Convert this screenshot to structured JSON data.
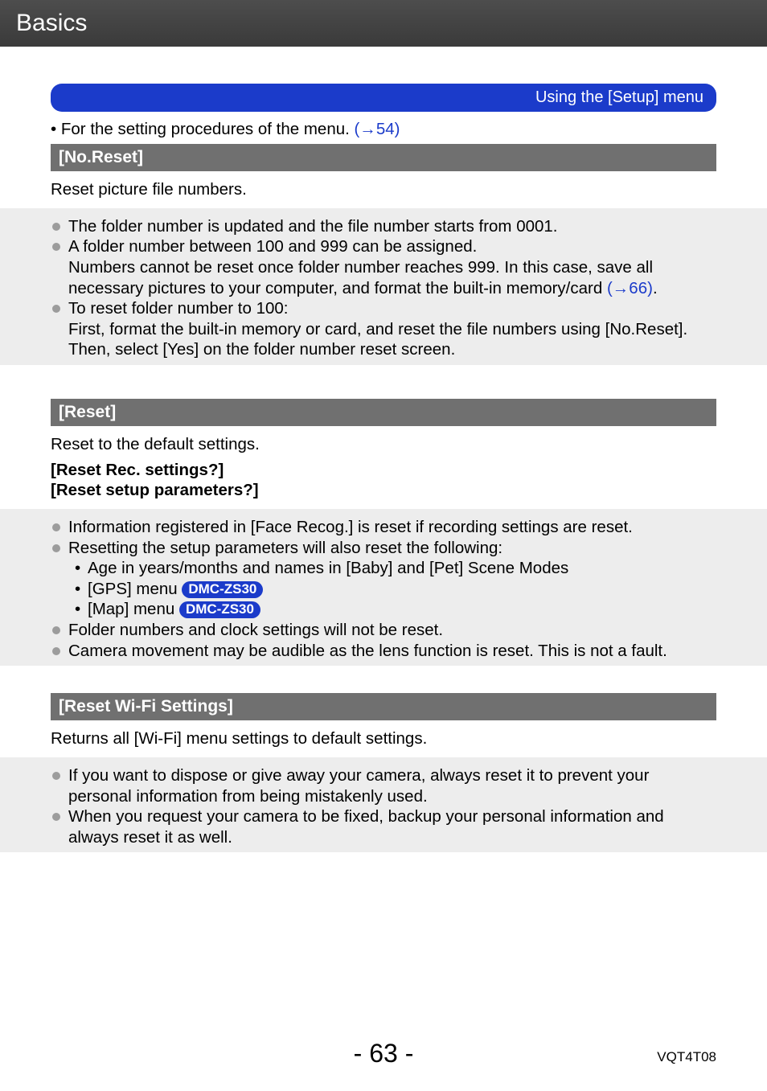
{
  "header": {
    "title": "Basics"
  },
  "banner": {
    "text": "Using the [Setup] menu"
  },
  "intro": {
    "prefix": " • For the setting procedures of the menu. ",
    "link": "(→54)"
  },
  "sections": {
    "noReset": {
      "title": "[No.Reset]",
      "desc": "Reset picture file numbers.",
      "bullets": {
        "b1": "The folder number is updated and the file number starts from 0001.",
        "b2": "A folder number between 100 and 999 can be assigned.",
        "b2c_prefix": "Numbers cannot be reset once folder number reaches 999. In this case, save all necessary pictures to your computer, and format the built-in memory/card ",
        "b2c_link": "(→66)",
        "b2c_suffix": ".",
        "b3": "To reset folder number to 100:",
        "b3c": "First, format the built-in memory or card, and reset the file numbers using [No.Reset]. Then, select [Yes] on the folder number reset screen."
      }
    },
    "reset": {
      "title": "[Reset]",
      "desc": "Reset to the default settings.",
      "bold1": "[Reset Rec. settings?]",
      "bold2": "[Reset setup parameters?]",
      "bullets": {
        "b1": "Information registered in [Face Recog.] is reset if recording settings are reset.",
        "b2": "Resetting the setup parameters will also reset the following:",
        "s1": "Age in years/months and names in [Baby] and [Pet] Scene Modes",
        "s2_label": "[GPS] menu ",
        "s2_badge": "DMC-ZS30",
        "s3_label": "[Map] menu ",
        "s3_badge": "DMC-ZS30",
        "b3": "Folder numbers and clock settings will not be reset.",
        "b4": "Camera movement may be audible as the lens function is reset. This is not a fault."
      }
    },
    "wifi": {
      "title": "[Reset Wi-Fi Settings]",
      "desc": "Returns all [Wi-Fi] menu settings to default settings.",
      "bullets": {
        "b1": "If you want to dispose or give away your camera, always reset it to prevent your personal information from being mistakenly used.",
        "b2": "When you request your camera to be fixed, backup your personal information and always reset it as well."
      }
    }
  },
  "footer": {
    "page": "- 63 -",
    "docid": "VQT4T08"
  }
}
